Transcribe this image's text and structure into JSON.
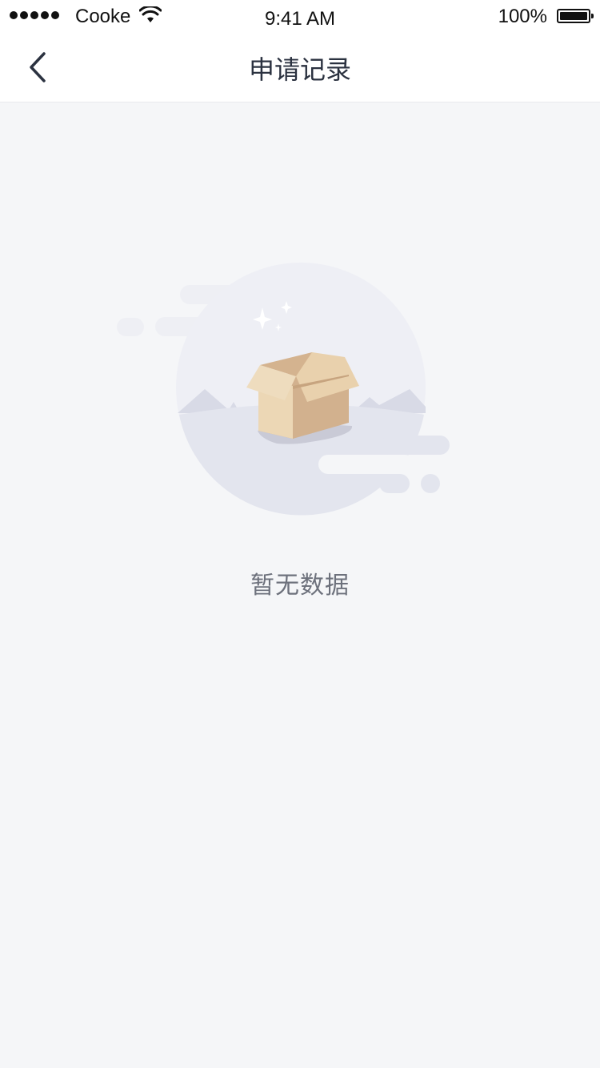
{
  "status_bar": {
    "carrier": "Cooke",
    "time": "9:41 AM",
    "battery": "100%",
    "signal_icon": "signal-dots-icon",
    "wifi_icon": "wifi-icon",
    "battery_icon": "battery-icon"
  },
  "nav": {
    "title": "申请记录",
    "back_icon": "chevron-left-icon"
  },
  "empty": {
    "message": "暂无数据",
    "illustration": "empty-box-icon"
  },
  "colors": {
    "background": "#f5f6f8",
    "title": "#2b3240",
    "empty_text": "#6d717c",
    "box_light": "#ecd7b5",
    "box_dark": "#d2b18e"
  }
}
